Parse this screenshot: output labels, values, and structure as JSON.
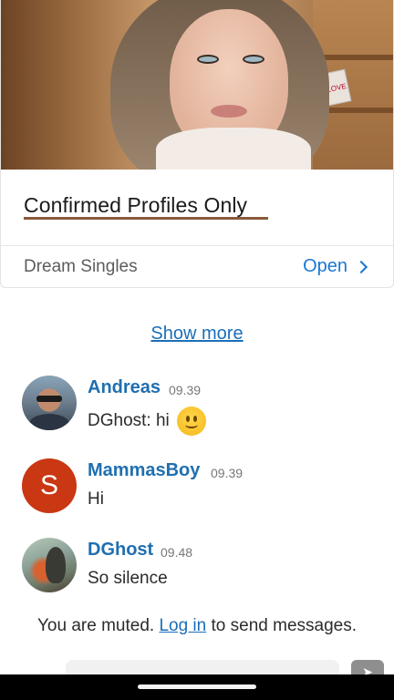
{
  "ad": {
    "title": "Confirmed Profiles Only",
    "source": "Dream Singles",
    "open_label": "Open",
    "box_text": "LOVE"
  },
  "show_more_label": "Show more",
  "messages": [
    {
      "name": "Andreas",
      "time": "09.39",
      "text": "DGhost: hi",
      "emoji": "slightly-smiling-face-icon",
      "avatar": "photo"
    },
    {
      "name": "MammasBoy",
      "time": "09.39",
      "text": "Hi",
      "avatar_letter": "S",
      "avatar_color": "#c93713"
    },
    {
      "name": "DGhost",
      "time": "09.48",
      "text": "So silence",
      "avatar": "photo"
    }
  ],
  "muted": {
    "prefix": "You are muted.",
    "login_label": "Log in",
    "suffix": "to send messages."
  },
  "colors": {
    "link": "#1b6fb8",
    "open": "#1b76d2",
    "name": "#1f6fb0"
  }
}
